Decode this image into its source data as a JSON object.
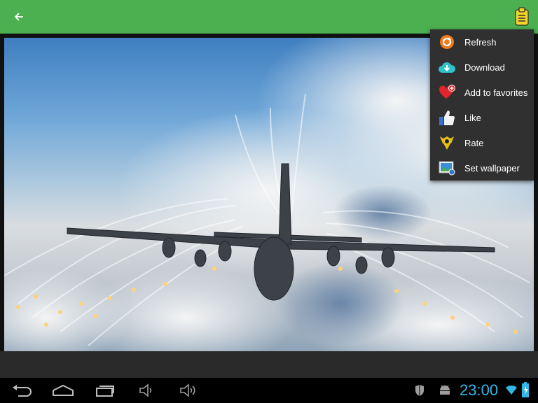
{
  "appbar": {
    "color": "#4caf50",
    "back_icon": "arrow-left-icon",
    "action_icon": "clipboard-icon"
  },
  "menu": {
    "items": [
      {
        "label": "Refresh",
        "icon": "refresh-icon"
      },
      {
        "label": "Download",
        "icon": "cloud-download-icon"
      },
      {
        "label": "Add to favorites",
        "icon": "heart-plus-icon"
      },
      {
        "label": "Like",
        "icon": "thumbs-up-icon"
      },
      {
        "label": "Rate",
        "icon": "rate-icon"
      },
      {
        "label": "Set wallpaper",
        "icon": "wallpaper-icon"
      }
    ]
  },
  "status": {
    "time": "23:00",
    "accent": "#33b5e5"
  },
  "navbar": {
    "buttons": [
      "back-icon",
      "home-icon",
      "recent-apps-icon",
      "volume-down-icon",
      "volume-up-icon"
    ]
  }
}
